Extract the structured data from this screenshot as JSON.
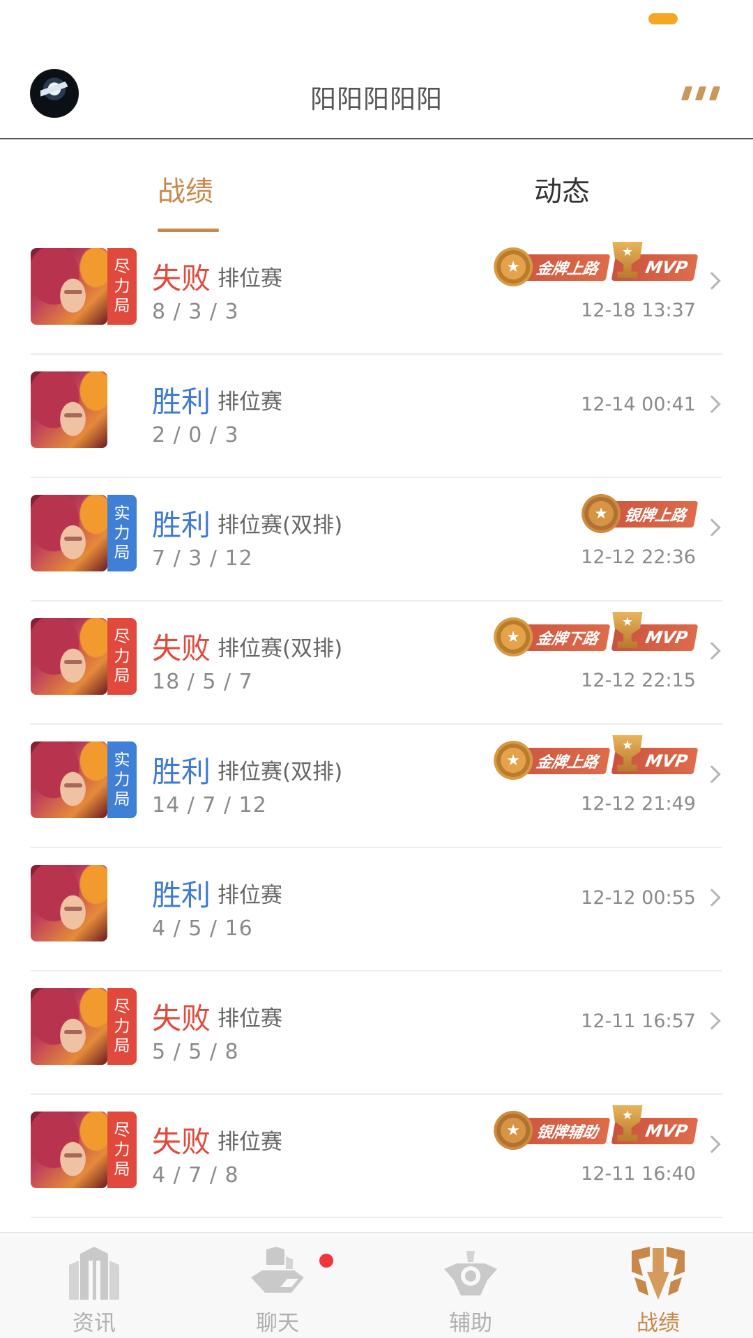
{
  "status_bar": {
    "indicator_color": "#f5a623"
  },
  "header": {
    "title": "阳阳阳阳阳",
    "more_icon": "more-dashes-icon",
    "avatar": "user-avatar"
  },
  "tabs": [
    {
      "label": "战绩",
      "active": true
    },
    {
      "label": "动态",
      "active": false
    }
  ],
  "colors": {
    "accent": "#c8884a",
    "win": "#3f7bd4",
    "lose": "#e0493c",
    "tag_red": "#e0493c",
    "tag_blue": "#3f7fd6"
  },
  "matches": [
    {
      "tag": [
        "尽",
        "力",
        "局"
      ],
      "tag_color": "red",
      "result": "失败",
      "outcome": "lose",
      "mode": "排位赛",
      "kda": "8 / 3 / 3",
      "time": "12-18 13:37",
      "badges": [
        {
          "type": "rank",
          "tier": "gold",
          "text": "金牌上路"
        },
        {
          "type": "mvp",
          "text": "MVP"
        }
      ]
    },
    {
      "tag": [],
      "tag_color": "",
      "result": "胜利",
      "outcome": "win",
      "mode": "排位赛",
      "kda": "2 / 0 / 3",
      "time": "12-14 00:41",
      "badges": []
    },
    {
      "tag": [
        "实",
        "力",
        "局"
      ],
      "tag_color": "blue",
      "result": "胜利",
      "outcome": "win",
      "mode": "排位赛(双排)",
      "kda": "7 / 3 / 12",
      "time": "12-12 22:36",
      "badges": [
        {
          "type": "rank",
          "tier": "silver",
          "text": "银牌上路"
        }
      ]
    },
    {
      "tag": [
        "尽",
        "力",
        "局"
      ],
      "tag_color": "red",
      "result": "失败",
      "outcome": "lose",
      "mode": "排位赛(双排)",
      "kda": "18 / 5 / 7",
      "time": "12-12 22:15",
      "badges": [
        {
          "type": "rank",
          "tier": "gold",
          "text": "金牌下路"
        },
        {
          "type": "mvp",
          "text": "MVP"
        }
      ]
    },
    {
      "tag": [
        "实",
        "力",
        "局"
      ],
      "tag_color": "blue",
      "result": "胜利",
      "outcome": "win",
      "mode": "排位赛(双排)",
      "kda": "14 / 7 / 12",
      "time": "12-12 21:49",
      "badges": [
        {
          "type": "rank",
          "tier": "gold",
          "text": "金牌上路"
        },
        {
          "type": "mvp",
          "text": "MVP"
        }
      ]
    },
    {
      "tag": [],
      "tag_color": "",
      "result": "胜利",
      "outcome": "win",
      "mode": "排位赛",
      "kda": "4 / 5 / 16",
      "time": "12-12 00:55",
      "badges": []
    },
    {
      "tag": [
        "尽",
        "力",
        "局"
      ],
      "tag_color": "red",
      "result": "失败",
      "outcome": "lose",
      "mode": "排位赛",
      "kda": "5 / 5 / 8",
      "time": "12-11 16:57",
      "badges": []
    },
    {
      "tag": [
        "尽",
        "力",
        "局"
      ],
      "tag_color": "red",
      "result": "失败",
      "outcome": "lose",
      "mode": "排位赛",
      "kda": "4 / 7 / 8",
      "time": "12-11 16:40",
      "badges": [
        {
          "type": "rank",
          "tier": "silver",
          "text": "银牌辅助"
        },
        {
          "type": "mvp",
          "text": "MVP"
        }
      ]
    }
  ],
  "bottom_nav": [
    {
      "label": "资讯",
      "icon": "news-icon",
      "active": false,
      "notification": false
    },
    {
      "label": "聊天",
      "icon": "chat-icon",
      "active": false,
      "notification": true
    },
    {
      "label": "辅助",
      "icon": "assist-icon",
      "active": false,
      "notification": false
    },
    {
      "label": "战绩",
      "icon": "record-icon",
      "active": true,
      "notification": false
    }
  ]
}
